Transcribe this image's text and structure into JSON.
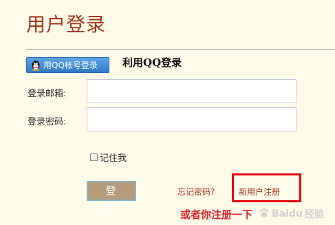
{
  "header": {
    "title": "用户登录"
  },
  "qq_login": {
    "button_label": "用QQ帐号登录",
    "heading": "利用QQ登录"
  },
  "form": {
    "email_label": "登录邮箱:",
    "email_value": "",
    "password_label": "登录密码:",
    "password_value": "",
    "remember_label": "记住我",
    "remember_checked": false,
    "submit_label": "登录"
  },
  "links": {
    "forgot_password": "忘记密码?",
    "register": "新用户注册"
  },
  "annotation": {
    "text": "或者你注册一下"
  },
  "watermark": {
    "brand": "Baidu",
    "suffix": "经验"
  },
  "colors": {
    "background": "#fffbe9",
    "title": "#a5321c",
    "link": "#a5321c",
    "highlight_box": "#e60012",
    "annotation": "#e0202a",
    "qq_button": "#2f79c5",
    "submit_button": "#b59b7a"
  },
  "icons": {
    "qq": "qq-penguin-icon",
    "watermark": "baidu-paw-icon"
  }
}
